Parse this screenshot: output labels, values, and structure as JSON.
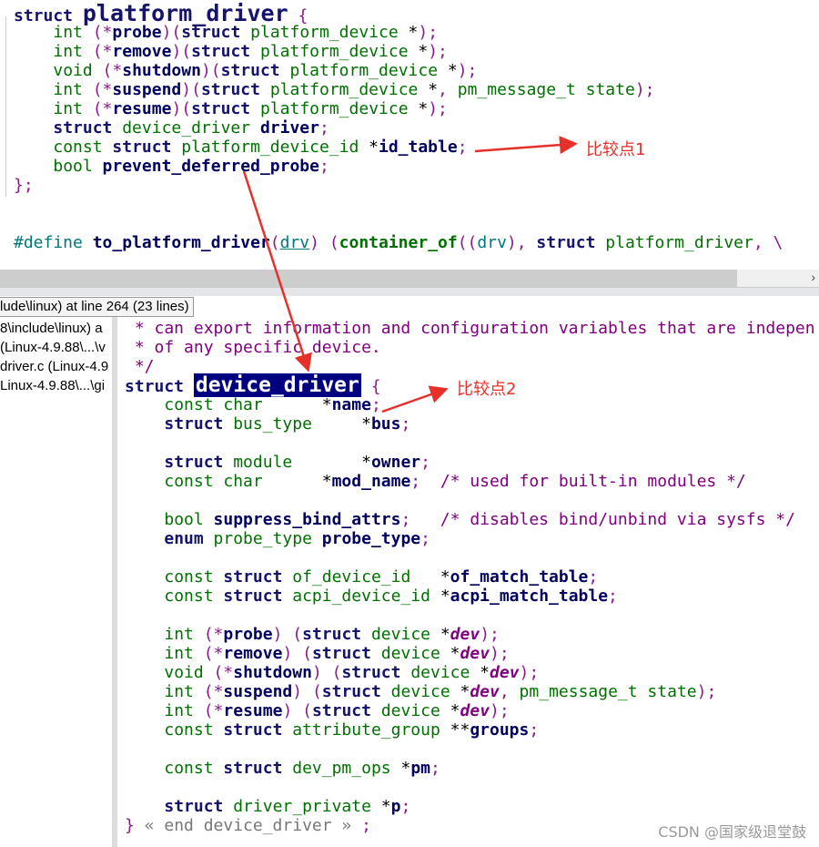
{
  "top_code": [
    [
      [
        "k",
        "struct "
      ],
      [
        "big",
        "platform_driver"
      ],
      [
        "p",
        " {"
      ]
    ],
    [
      [
        "n",
        "    "
      ],
      [
        "t",
        "int "
      ],
      [
        "p",
        "(*"
      ],
      [
        "i",
        "probe"
      ],
      [
        "p",
        ")("
      ],
      [
        "k",
        "struct "
      ],
      [
        "t",
        "platform_device "
      ],
      [
        "n",
        "*"
      ],
      [
        "p",
        ");"
      ]
    ],
    [
      [
        "n",
        "    "
      ],
      [
        "t",
        "int "
      ],
      [
        "p",
        "(*"
      ],
      [
        "i",
        "remove"
      ],
      [
        "p",
        ")("
      ],
      [
        "k",
        "struct "
      ],
      [
        "t",
        "platform_device "
      ],
      [
        "n",
        "*"
      ],
      [
        "p",
        ");"
      ]
    ],
    [
      [
        "n",
        "    "
      ],
      [
        "t",
        "void "
      ],
      [
        "p",
        "(*"
      ],
      [
        "i",
        "shutdown"
      ],
      [
        "p",
        ")("
      ],
      [
        "k",
        "struct "
      ],
      [
        "t",
        "platform_device "
      ],
      [
        "n",
        "*"
      ],
      [
        "p",
        ");"
      ]
    ],
    [
      [
        "n",
        "    "
      ],
      [
        "t",
        "int "
      ],
      [
        "p",
        "(*"
      ],
      [
        "i",
        "suspend"
      ],
      [
        "p",
        ")("
      ],
      [
        "k",
        "struct "
      ],
      [
        "t",
        "platform_device "
      ],
      [
        "n",
        "*"
      ],
      [
        "p",
        ", "
      ],
      [
        "t",
        "pm_message_t state"
      ],
      [
        "p",
        ");"
      ]
    ],
    [
      [
        "n",
        "    "
      ],
      [
        "t",
        "int "
      ],
      [
        "p",
        "(*"
      ],
      [
        "i",
        "resume"
      ],
      [
        "p",
        ")("
      ],
      [
        "k",
        "struct "
      ],
      [
        "t",
        "platform_device "
      ],
      [
        "n",
        "*"
      ],
      [
        "p",
        ");"
      ]
    ],
    [
      [
        "n",
        "    "
      ],
      [
        "k",
        "struct "
      ],
      [
        "t",
        "device_driver "
      ],
      [
        "i",
        "driver"
      ],
      [
        "p",
        ";"
      ]
    ],
    [
      [
        "n",
        "    "
      ],
      [
        "t",
        "const "
      ],
      [
        "k",
        "struct "
      ],
      [
        "t",
        "platform_device_id "
      ],
      [
        "n",
        "*"
      ],
      [
        "i",
        "id_table"
      ],
      [
        "p",
        ";"
      ]
    ],
    [
      [
        "n",
        "    "
      ],
      [
        "t",
        "bool "
      ],
      [
        "i",
        "prevent_deferred_probe"
      ],
      [
        "p",
        ";"
      ]
    ],
    [
      [
        "p",
        "};"
      ]
    ],
    [],
    [],
    [
      [
        "v",
        "#define "
      ],
      [
        "i",
        "to_platform_driver"
      ],
      [
        "p",
        "("
      ],
      [
        "u",
        "drv"
      ],
      [
        "p",
        ") ("
      ],
      [
        "f",
        "container_of"
      ],
      [
        "p",
        "(("
      ],
      [
        "v",
        "drv"
      ],
      [
        "p",
        "), "
      ],
      [
        "k",
        "struct "
      ],
      [
        "t",
        "platform_driver"
      ],
      [
        "p",
        ", \\"
      ]
    ]
  ],
  "panel_header": "lude\\linux) at line 264 (23 lines)",
  "left_list": [
    "8\\include\\linux) a",
    "(Linux-4.9.88\\...\\v",
    "driver.c (Linux-4.9",
    "Linux-4.9.88\\...\\gi"
  ],
  "bottom_code": [
    [
      [
        "c",
        " * can export information and configuration variables that are indepen"
      ]
    ],
    [
      [
        "c",
        " * of any specific device."
      ]
    ],
    [
      [
        "c",
        " */"
      ]
    ],
    [
      [
        "k",
        "struct "
      ],
      [
        "hl",
        "device_driver"
      ],
      [
        "p",
        " {"
      ]
    ],
    [
      [
        "n",
        "    "
      ],
      [
        "t",
        "const char"
      ],
      [
        "n",
        "      *"
      ],
      [
        "i",
        "name"
      ],
      [
        "p",
        ";"
      ]
    ],
    [
      [
        "n",
        "    "
      ],
      [
        "k",
        "struct "
      ],
      [
        "t",
        "bus_type"
      ],
      [
        "n",
        "     *"
      ],
      [
        "i",
        "bus"
      ],
      [
        "p",
        ";"
      ]
    ],
    [],
    [
      [
        "n",
        "    "
      ],
      [
        "k",
        "struct "
      ],
      [
        "t",
        "module"
      ],
      [
        "n",
        "       *"
      ],
      [
        "i",
        "owner"
      ],
      [
        "p",
        ";"
      ]
    ],
    [
      [
        "n",
        "    "
      ],
      [
        "t",
        "const char"
      ],
      [
        "n",
        "      *"
      ],
      [
        "i",
        "mod_name"
      ],
      [
        "p",
        ";"
      ],
      [
        "c",
        "  /* used for built-in modules */"
      ]
    ],
    [],
    [
      [
        "n",
        "    "
      ],
      [
        "t",
        "bool "
      ],
      [
        "i",
        "suppress_bind_attrs"
      ],
      [
        "p",
        ";"
      ],
      [
        "c",
        "   /* disables bind/unbind via sysfs */"
      ]
    ],
    [
      [
        "n",
        "    "
      ],
      [
        "k",
        "enum "
      ],
      [
        "t",
        "probe_type "
      ],
      [
        "i",
        "probe_type"
      ],
      [
        "p",
        ";"
      ]
    ],
    [],
    [
      [
        "n",
        "    "
      ],
      [
        "t",
        "const "
      ],
      [
        "k",
        "struct "
      ],
      [
        "t",
        "of_device_id"
      ],
      [
        "n",
        "   *"
      ],
      [
        "i",
        "of_match_table"
      ],
      [
        "p",
        ";"
      ]
    ],
    [
      [
        "n",
        "    "
      ],
      [
        "t",
        "const "
      ],
      [
        "k",
        "struct "
      ],
      [
        "t",
        "acpi_device_id "
      ],
      [
        "n",
        "*"
      ],
      [
        "i",
        "acpi_match_table"
      ],
      [
        "p",
        ";"
      ]
    ],
    [],
    [
      [
        "n",
        "    "
      ],
      [
        "t",
        "int "
      ],
      [
        "p",
        "(*"
      ],
      [
        "i",
        "probe"
      ],
      [
        "p",
        ") ("
      ],
      [
        "k",
        "struct "
      ],
      [
        "t",
        "device "
      ],
      [
        "n",
        "*"
      ],
      [
        "a",
        "dev"
      ],
      [
        "p",
        ");"
      ]
    ],
    [
      [
        "n",
        "    "
      ],
      [
        "t",
        "int "
      ],
      [
        "p",
        "(*"
      ],
      [
        "i",
        "remove"
      ],
      [
        "p",
        ") ("
      ],
      [
        "k",
        "struct "
      ],
      [
        "t",
        "device "
      ],
      [
        "n",
        "*"
      ],
      [
        "a",
        "dev"
      ],
      [
        "p",
        ");"
      ]
    ],
    [
      [
        "n",
        "    "
      ],
      [
        "t",
        "void "
      ],
      [
        "p",
        "(*"
      ],
      [
        "i",
        "shutdown"
      ],
      [
        "p",
        ") ("
      ],
      [
        "k",
        "struct "
      ],
      [
        "t",
        "device "
      ],
      [
        "n",
        "*"
      ],
      [
        "a",
        "dev"
      ],
      [
        "p",
        ");"
      ]
    ],
    [
      [
        "n",
        "    "
      ],
      [
        "t",
        "int "
      ],
      [
        "p",
        "(*"
      ],
      [
        "i",
        "suspend"
      ],
      [
        "p",
        ") ("
      ],
      [
        "k",
        "struct "
      ],
      [
        "t",
        "device "
      ],
      [
        "n",
        "*"
      ],
      [
        "a",
        "dev"
      ],
      [
        "p",
        ", "
      ],
      [
        "t",
        "pm_message_t state"
      ],
      [
        "p",
        ");"
      ]
    ],
    [
      [
        "n",
        "    "
      ],
      [
        "t",
        "int "
      ],
      [
        "p",
        "(*"
      ],
      [
        "i",
        "resume"
      ],
      [
        "p",
        ") ("
      ],
      [
        "k",
        "struct "
      ],
      [
        "t",
        "device "
      ],
      [
        "n",
        "*"
      ],
      [
        "a",
        "dev"
      ],
      [
        "p",
        ");"
      ]
    ],
    [
      [
        "n",
        "    "
      ],
      [
        "t",
        "const "
      ],
      [
        "k",
        "struct "
      ],
      [
        "t",
        "attribute_group "
      ],
      [
        "n",
        "**"
      ],
      [
        "i",
        "groups"
      ],
      [
        "p",
        ";"
      ]
    ],
    [],
    [
      [
        "n",
        "    "
      ],
      [
        "t",
        "const "
      ],
      [
        "k",
        "struct "
      ],
      [
        "t",
        "dev_pm_ops "
      ],
      [
        "n",
        "*"
      ],
      [
        "i",
        "pm"
      ],
      [
        "p",
        ";"
      ]
    ],
    [],
    [
      [
        "n",
        "    "
      ],
      [
        "k",
        "struct "
      ],
      [
        "t",
        "driver_private "
      ],
      [
        "n",
        "*"
      ],
      [
        "i",
        "p"
      ],
      [
        "p",
        ";"
      ]
    ],
    [
      [
        "p",
        "}"
      ],
      [
        "g",
        " « end device_driver » "
      ],
      [
        "p",
        ";"
      ]
    ]
  ],
  "annotations": {
    "label1": "比较点1",
    "label2": "比较点2",
    "arrow_color": "#e8302a"
  },
  "scroll_right_icon": "chevron-right-icon",
  "watermark": "CSDN @国家级退堂鼓"
}
